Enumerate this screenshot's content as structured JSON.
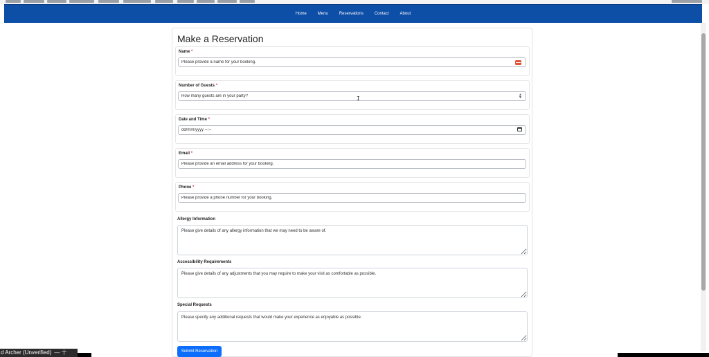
{
  "nav": {
    "links": [
      "Home",
      "Menu",
      "Reservations",
      "Contact",
      "About"
    ]
  },
  "page": {
    "title": "Make a Reservation"
  },
  "form": {
    "required_marker": "*",
    "name": {
      "label": "Name",
      "placeholder": "Please provide a name for your booking."
    },
    "guests": {
      "label": "Number of Guests",
      "placeholder": "How many guests are in your party?"
    },
    "datetime": {
      "label": "Date and Time",
      "placeholder": "dd/mm/yyyy --:--"
    },
    "email": {
      "label": "Email",
      "placeholder": "Please provide an email address for your booking."
    },
    "phone": {
      "label": "Phone",
      "placeholder": "Please provide a phone number for your booking."
    },
    "allergy": {
      "label": "Allergy Information",
      "placeholder": "Please give details of any allergy information that we may need to be aware of."
    },
    "accessibility": {
      "label": "Accessibility Requirements",
      "placeholder": "Please give details of any adjustments that you may require to make your visit as comfortable as possible."
    },
    "special": {
      "label": "Special Requests",
      "placeholder": "Please specify any additional requests that would make your experience as enjoyable as possible."
    },
    "submit_label": "Submit Reservation"
  },
  "taskbar": {
    "user_label": "d Archer (Unverified)",
    "symbols": "—  十"
  },
  "colors": {
    "navbar": "#0d4ea6",
    "primary_button": "#0d6efd",
    "required": "#dc3545"
  }
}
